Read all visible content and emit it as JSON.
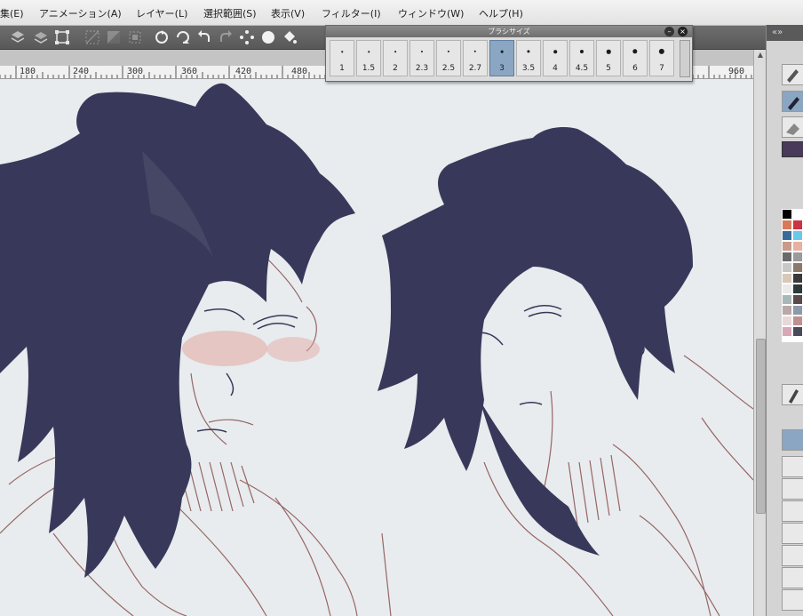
{
  "menu": {
    "edit": "集(E)",
    "animation": "アニメーション(A)",
    "layer": "レイヤー(L)",
    "selection": "選択範囲(S)",
    "view": "表示(V)",
    "filter": "フィルター(I)",
    "window": "ウィンドウ(W)",
    "help": "ヘルプ(H)"
  },
  "brush_size_palette": {
    "title": "ブラシサイズ",
    "sizes": [
      "1",
      "1.5",
      "2",
      "2.3",
      "2.5",
      "2.7",
      "3",
      "3.5",
      "4",
      "4.5",
      "5",
      "6",
      "7"
    ],
    "selected": "3"
  },
  "ruler": {
    "ticks": [
      "180",
      "240",
      "300",
      "360",
      "420",
      "480",
      "960"
    ]
  },
  "colors": {
    "canvas_bg": "#e8ecee",
    "hair": "#38395a",
    "sketch_line": "#8a4e4e",
    "blush": "#e2a7a0",
    "selected_brush": "#8aa6c2",
    "current_color": "#4a3a5a"
  },
  "palette_swatches": [
    "#000000",
    "#ffffff",
    "#d87a5a",
    "#cc3344",
    "#3a6a9a",
    "#6ac8e8",
    "#c89a8a",
    "#e8b0a0",
    "#6a6a6a",
    "#9a9a9a",
    "#c8c8c8",
    "#8a7a6a",
    "#d8c8b8",
    "#3a3a3a",
    "#eaeaea",
    "#2a3a3a",
    "#a8b8b8",
    "#5a4a4a",
    "#b8a8a8",
    "#8a9aa8",
    "#e8d8d8",
    "#c09090",
    "#d8a8b8",
    "#4a4a5a"
  ]
}
